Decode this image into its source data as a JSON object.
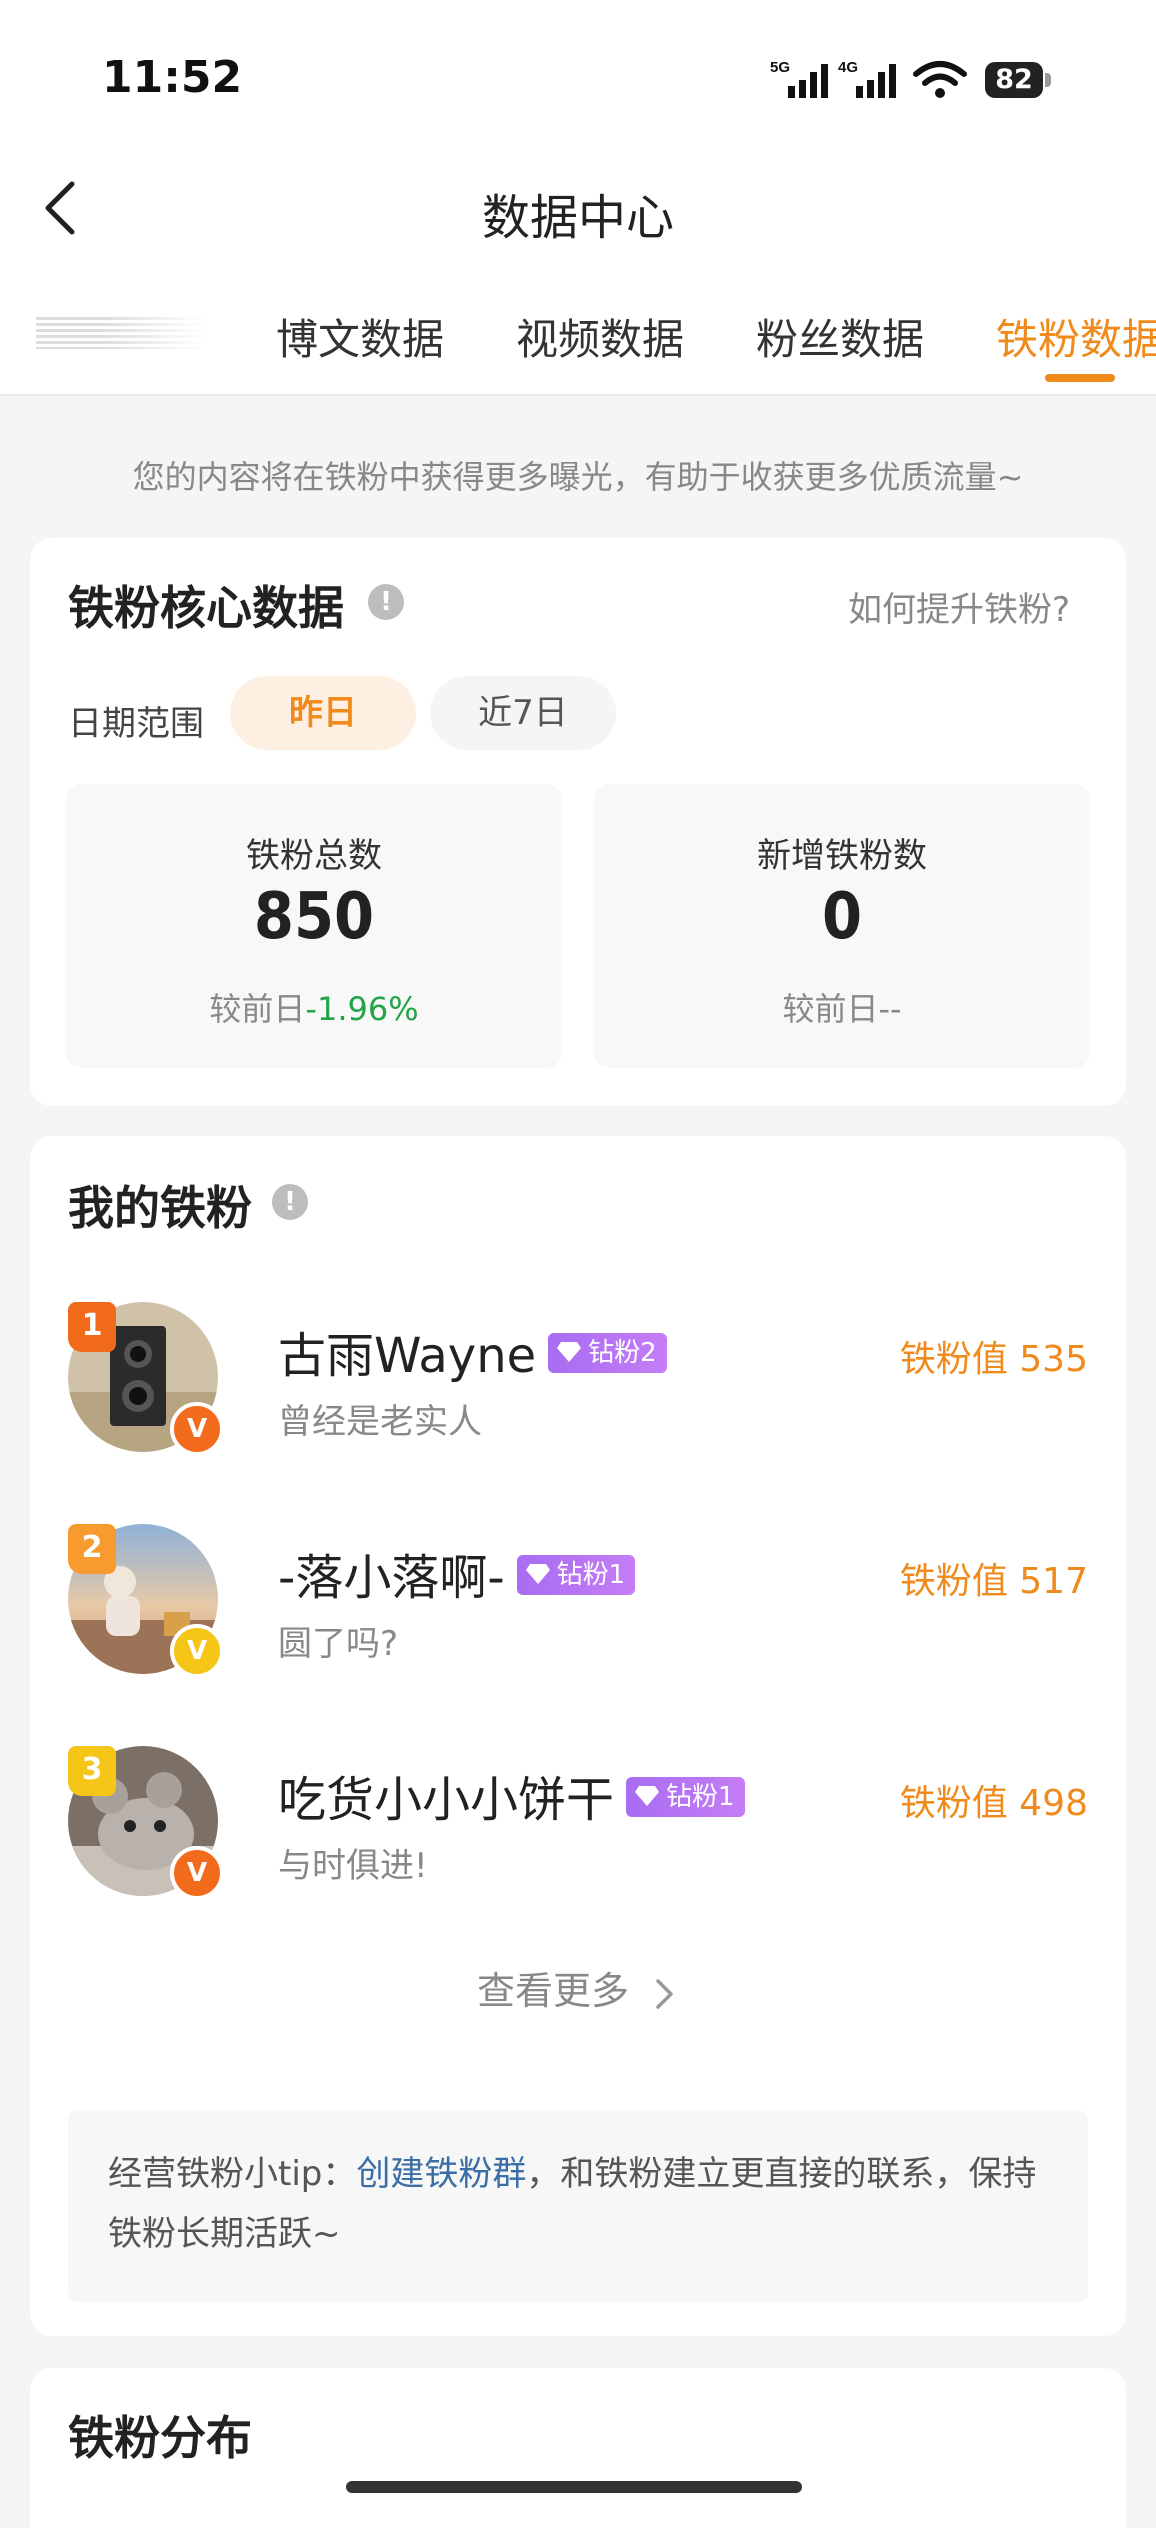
{
  "status_bar": {
    "time": "11:52",
    "signal1": "5G",
    "signal2": "4G",
    "battery": "82"
  },
  "nav": {
    "title": "数据中心",
    "back_icon": "chevron-left-icon"
  },
  "tabs": [
    {
      "label": "博文数据",
      "active": false
    },
    {
      "label": "视频数据",
      "active": false
    },
    {
      "label": "粉丝数据",
      "active": false
    },
    {
      "label": "铁粉数据",
      "active": true
    }
  ],
  "notice": "您的内容将在铁粉中获得更多曝光，有助于收获更多优质流量~",
  "core": {
    "title": "铁粉核心数据",
    "help_link": "如何提升铁粉?",
    "date_label": "日期范围",
    "ranges": [
      "昨日",
      "近7日"
    ],
    "stats": [
      {
        "label": "铁粉总数",
        "value": "850",
        "compare_prefix": "较前日",
        "compare_value": "-1.96%"
      },
      {
        "label": "新增铁粉数",
        "value": "0",
        "compare_prefix": "较前日",
        "compare_value": "--"
      }
    ]
  },
  "my_fans": {
    "title": "我的铁粉",
    "items": [
      {
        "rank": "1",
        "name": "古雨Wayne",
        "level": "钻粉2",
        "bio": "曾经是老实人",
        "score": "铁粉值 535",
        "badge": "V",
        "rank_color": "#f26b1d",
        "v_color": "#f26b1d"
      },
      {
        "rank": "2",
        "name": "-落小落啊-",
        "level": "钻粉1",
        "bio": "圆了吗?",
        "score": "铁粉值 517",
        "badge": "V",
        "rank_color": "#f79b2e",
        "v_color": "#f5c518"
      },
      {
        "rank": "3",
        "name": "吃货小小小饼干",
        "level": "钻粉1",
        "bio": "与时俱进!",
        "score": "铁粉值 498",
        "badge": "V",
        "rank_color": "#f5c518",
        "v_color": "#f26b1d"
      }
    ],
    "see_more": "查看更多",
    "tip_prefix": "经营铁粉小tip：",
    "tip_link": "创建铁粉群",
    "tip_suffix": "，和铁粉建立更直接的联系，保持铁粉长期活跃~"
  },
  "distribution": {
    "title": "铁粉分布"
  },
  "colors": {
    "accent": "#f08a1c",
    "down": "#22a447",
    "link": "#3a6ea5"
  }
}
